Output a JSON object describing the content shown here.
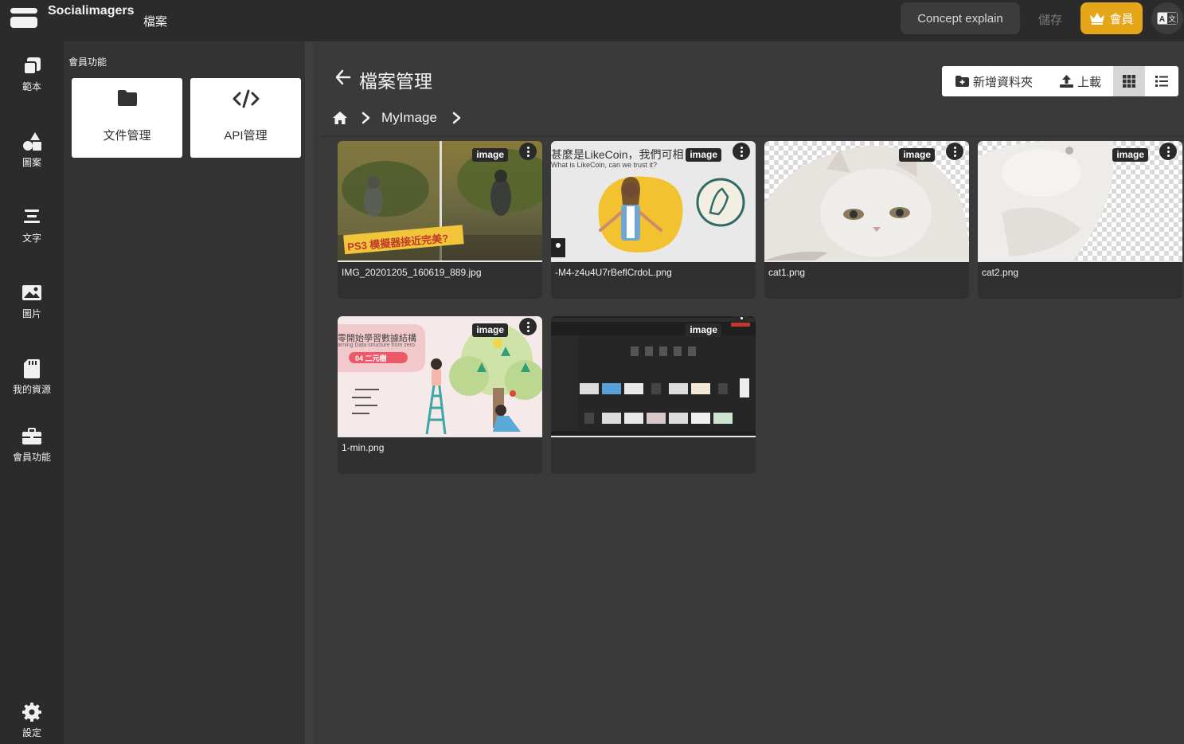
{
  "app": {
    "brand": "Socialimagers",
    "menu_file": "檔案",
    "concept_button": "Concept explain",
    "save_button": "儲存",
    "member_button": "會員",
    "member_color": "#e6a619"
  },
  "sidebar": {
    "items": [
      {
        "label": "範本",
        "icon": "template-icon"
      },
      {
        "label": "圖案",
        "icon": "shapes-icon"
      },
      {
        "label": "文字",
        "icon": "text-icon"
      },
      {
        "label": "圖片",
        "icon": "image-icon"
      },
      {
        "label": "我的資源",
        "icon": "sd-card-icon"
      },
      {
        "label": "會員功能",
        "icon": "briefcase-icon"
      }
    ],
    "settings_label": "設定"
  },
  "panel": {
    "title": "會員功能",
    "cards": [
      {
        "label": "文件管理",
        "icon": "folder-icon"
      },
      {
        "label": "API管理",
        "icon": "code-icon"
      }
    ]
  },
  "main": {
    "title": "檔案管理",
    "toolbar": {
      "new_folder": "新增資料夾",
      "upload": "上載",
      "view_mode": "grid"
    },
    "breadcrumb": {
      "folder": "MyImage"
    },
    "files": [
      {
        "name": "IMG_20201205_160619_889.jpg",
        "type": "image",
        "thumb_caption": "PS3 模擬器接近完美?"
      },
      {
        "name": "-M4-z4u4U7rBeflCrdoL.png",
        "type": "image",
        "thumb_caption": "甚麼是LikeCoin，我們可相",
        "thumb_subcaption": "What is LikeCoin, can we trust it?"
      },
      {
        "name": "cat1.png",
        "type": "image"
      },
      {
        "name": "cat2.png",
        "type": "image"
      },
      {
        "name": "1-min.png",
        "type": "image",
        "thumb_caption": "零開始學習數據結構",
        "thumb_subcaption": "arning Data structure from zero",
        "thumb_tag": "04 二元樹"
      },
      {
        "name": "",
        "type": "image"
      }
    ]
  }
}
